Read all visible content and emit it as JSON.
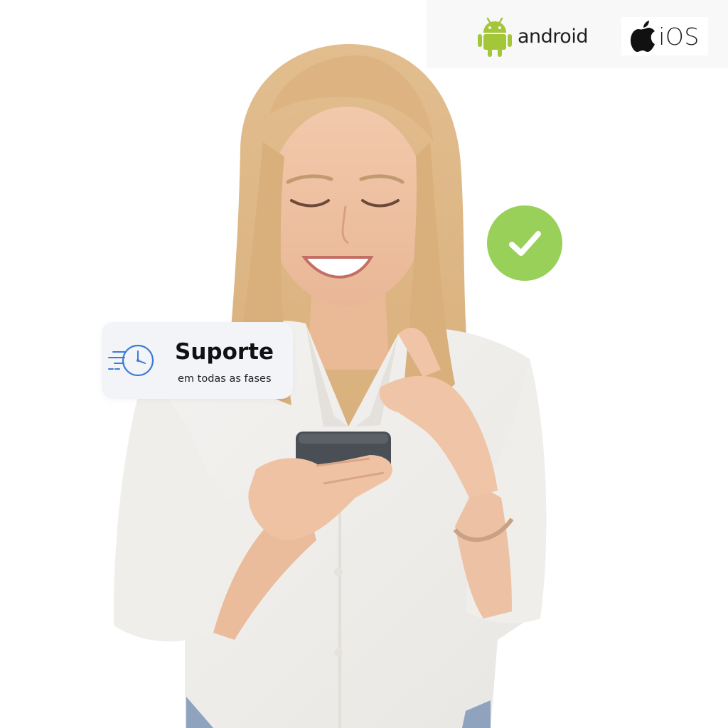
{
  "platforms": {
    "android_label": "android",
    "ios_label": "iOS"
  },
  "support_card": {
    "title": "Suporte",
    "subtitle": "em todas as fases"
  },
  "icons": {
    "android": "android-robot-icon",
    "apple": "apple-logo-icon",
    "check": "check-icon",
    "support": "fast-clock-icon"
  },
  "colors": {
    "android_green": "#a4c639",
    "check_green": "#98d05a",
    "clock_blue": "#3a7bd5",
    "card_bg": "#f2f4f8"
  }
}
